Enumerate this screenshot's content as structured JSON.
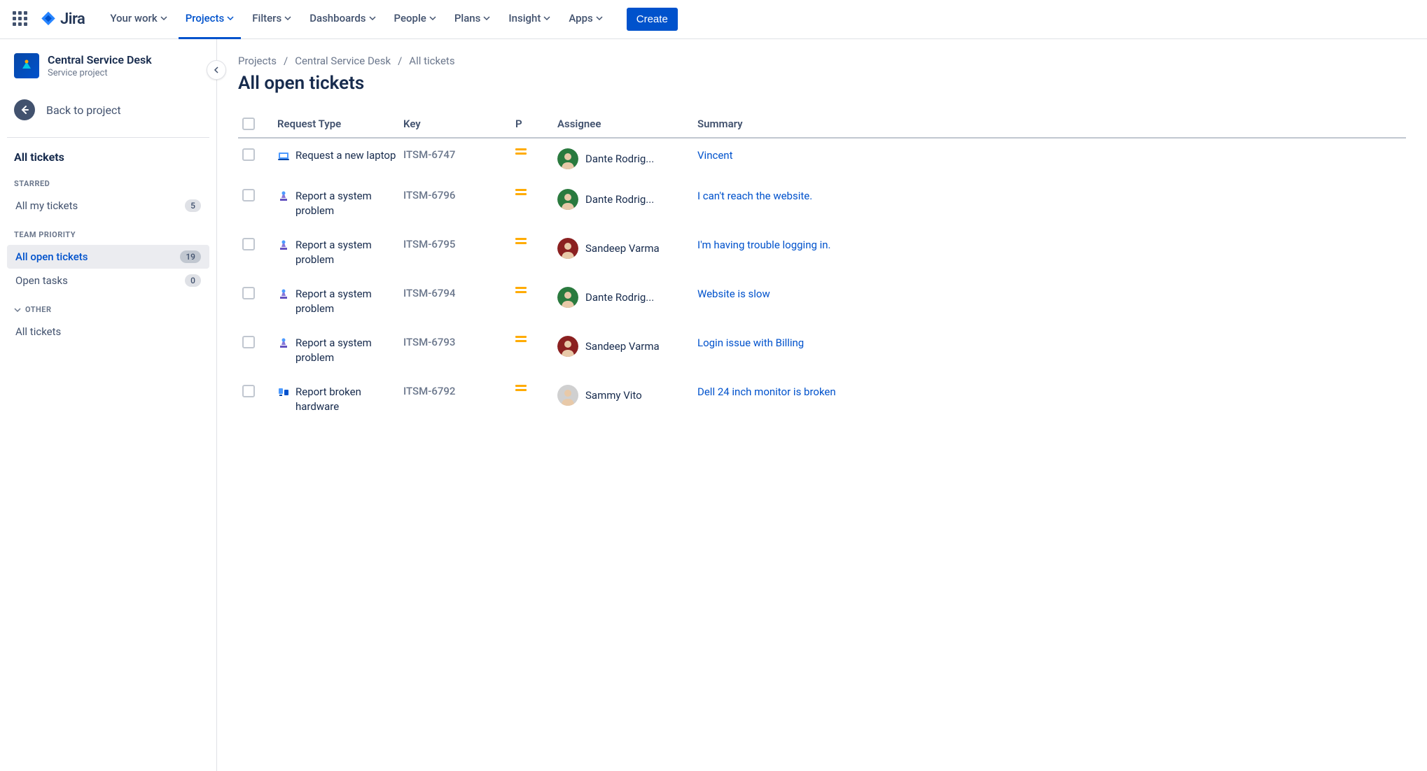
{
  "header": {
    "logo_name": "Jira",
    "nav": [
      {
        "label": "Your work",
        "active": false
      },
      {
        "label": "Projects",
        "active": true
      },
      {
        "label": "Filters",
        "active": false
      },
      {
        "label": "Dashboards",
        "active": false
      },
      {
        "label": "People",
        "active": false
      },
      {
        "label": "Plans",
        "active": false
      },
      {
        "label": "Insight",
        "active": false
      },
      {
        "label": "Apps",
        "active": false
      }
    ],
    "create_label": "Create"
  },
  "sidebar": {
    "project_name": "Central Service Desk",
    "project_type": "Service project",
    "back_label": "Back to project",
    "heading": "All tickets",
    "groups": {
      "starred_label": "STARRED",
      "team_priority_label": "TEAM PRIORITY",
      "other_label": "OTHER"
    },
    "starred_items": [
      {
        "label": "All my tickets",
        "count": "5"
      }
    ],
    "team_priority_items": [
      {
        "label": "All open tickets",
        "count": "19",
        "selected": true
      },
      {
        "label": "Open tasks",
        "count": "0",
        "selected": false
      }
    ],
    "other_items": [
      {
        "label": "All tickets"
      }
    ]
  },
  "breadcrumbs": {
    "root": "Projects",
    "project": "Central Service Desk",
    "current": "All tickets"
  },
  "page": {
    "title": "All open tickets"
  },
  "columns": {
    "request_type": "Request Type",
    "key": "Key",
    "priority": "P",
    "assignee": "Assignee",
    "summary": "Summary"
  },
  "tickets": [
    {
      "request_type": "Request a new laptop",
      "icon": "laptop",
      "key": "ITSM-6747",
      "assignee": "Dante Rodrig...",
      "avatar_color": "#2A7A3E",
      "summary": "Vincent"
    },
    {
      "request_type": "Report a system problem",
      "icon": "system",
      "key": "ITSM-6796",
      "assignee": "Dante Rodrig...",
      "avatar_color": "#2A7A3E",
      "summary": "I can't reach the website."
    },
    {
      "request_type": "Report a system problem",
      "icon": "system",
      "key": "ITSM-6795",
      "assignee": "Sandeep Varma",
      "avatar_color": "#8B2020",
      "summary": "I'm having trouble logging in."
    },
    {
      "request_type": "Report a system problem",
      "icon": "system",
      "key": "ITSM-6794",
      "assignee": "Dante Rodrig...",
      "avatar_color": "#2A7A3E",
      "summary": "Website is slow"
    },
    {
      "request_type": "Report a system problem",
      "icon": "system",
      "key": "ITSM-6793",
      "assignee": "Sandeep Varma",
      "avatar_color": "#8B2020",
      "summary": "Login issue with Billing"
    },
    {
      "request_type": "Report broken hardware",
      "icon": "hardware",
      "key": "ITSM-6792",
      "assignee": "Sammy Vito",
      "avatar_color": "#D0D0D0",
      "summary": "Dell 24 inch monitor is broken"
    }
  ]
}
